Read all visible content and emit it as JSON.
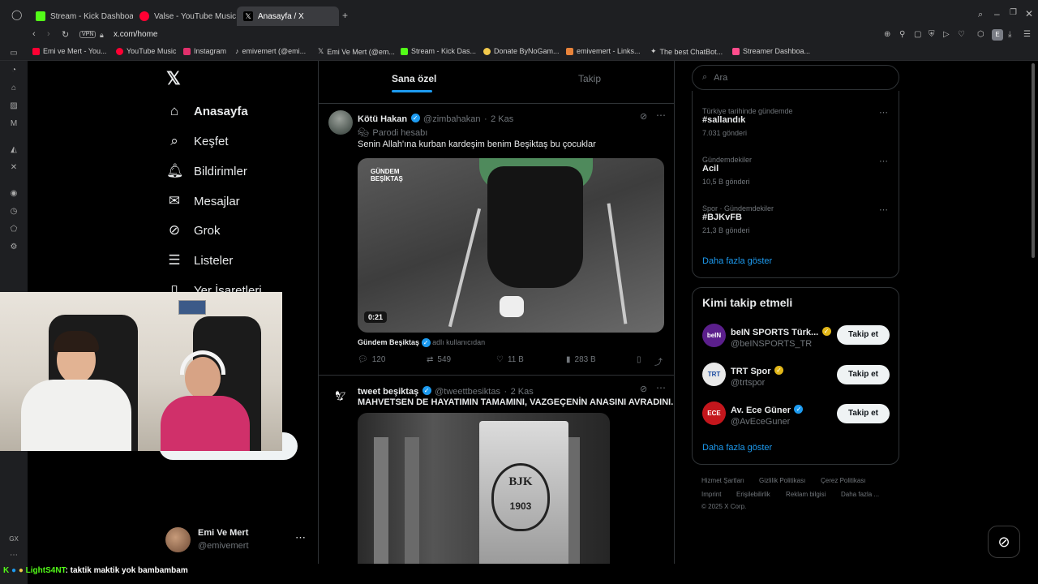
{
  "browser": {
    "tabs": [
      {
        "label": "Stream - Kick Dashboard",
        "color": "#53fc18"
      },
      {
        "label": "Valse - YouTube Music",
        "color": "#ff0033"
      },
      {
        "label": "Anasayfa / X",
        "color": "#ffffff"
      }
    ],
    "url": "x.com/home",
    "vpn_label": "VPN",
    "bookmarks": [
      {
        "label": "Emi ve Mert - You...",
        "color": "#ff0033"
      },
      {
        "label": "YouTube Music",
        "color": "#ff0033"
      },
      {
        "label": "Instagram",
        "color": "#e1306c"
      },
      {
        "label": "emivemert (@emi...",
        "color": "#ffffff"
      },
      {
        "label": "Emi Ve Mert (@em...",
        "color": "#ffffff"
      },
      {
        "label": "Stream - Kick Das...",
        "color": "#53fc18"
      },
      {
        "label": "Donate ByNoGam...",
        "color": "#f2c94c"
      },
      {
        "label": "emivemert - Links...",
        "color": "#e8833a"
      },
      {
        "label": "The best ChatBot...",
        "color": "#ffffff"
      },
      {
        "label": "Streamer Dashboa...",
        "color": "#ff4d8d"
      }
    ]
  },
  "nav": {
    "items": [
      "Anasayfa",
      "Keşfet",
      "Bildirimler",
      "Mesajlar",
      "Grok",
      "Listeler",
      "Yer İşaretleri"
    ],
    "profile_name": "Emi Ve Mert",
    "profile_handle": "@emivemert"
  },
  "feed": {
    "tabs": [
      "Sana özel",
      "Takip"
    ],
    "tweets": [
      {
        "name": "Kötü Hakan",
        "handle": "@zimbahakan",
        "time": "2 Kas",
        "label": "Parodi hesabı",
        "text": "Senin Allah'ına kurban kardeşim benim Beşiktaş bu çocuklar",
        "media_badge": "GÜNDEM BEŞİKTAŞ",
        "video_duration": "0:21",
        "source_name": "Gündem Beşiktaş",
        "source_suffix": "adlı kullanıcıdan",
        "replies": "120",
        "retweets": "549",
        "likes": "11 B",
        "views": "283 B"
      },
      {
        "name": "tweet beşiktaş",
        "handle": "@tweettbesiktas",
        "time": "2 Kas",
        "text": "MAHVETSEN DE HAYATIMIN TAMAMINI, VAZGEÇENİN ANASINI AVRADINI.",
        "flag_letters": "BJK",
        "flag_year": "1903"
      }
    ]
  },
  "right": {
    "search_placeholder": "Ara",
    "trends": [
      {
        "category": "Türkiye tarihinde gündemde",
        "name": "#sallandık",
        "count": "7.031 gönderi"
      },
      {
        "category": "Gündemdekiler",
        "name": "Acil",
        "count": "10,5 B gönderi"
      },
      {
        "category": "Spor · Gündemdekiler",
        "name": "#BJKvFB",
        "count": "21,3 B gönderi"
      }
    ],
    "show_more": "Daha fazla göster",
    "who_to_follow_title": "Kimi takip etmeli",
    "suggestions": [
      {
        "name": "beIN SPORTS Türk...",
        "handle": "@beINSPORTS_TR",
        "badge": "gold",
        "avatar_color": "#5b1f8c",
        "avatar_text": "beIN"
      },
      {
        "name": "TRT Spor",
        "handle": "@trtspor",
        "badge": "gold",
        "avatar_color": "#e9e9e9",
        "avatar_text": "TRT"
      },
      {
        "name": "Av. Ece Güner",
        "handle": "@AvEceGuner",
        "badge": "blue",
        "avatar_color": "#c4161c",
        "avatar_text": "ECE"
      }
    ],
    "follow_label": "Takip et",
    "footer": [
      "Hizmet Şartları",
      "Gizlilik Politikası",
      "Çerez Politikası",
      "Imprint",
      "Erişilebilirlik",
      "Reklam bilgisi",
      "Daha fazla ...",
      "© 2025 X Corp."
    ]
  },
  "chat": {
    "user": "LightS4NT",
    "message": ": taktik maktik yok bambambam"
  },
  "colors": {
    "accent": "#1d9bf0",
    "kick": "#53fc18",
    "bg": "#000000"
  }
}
